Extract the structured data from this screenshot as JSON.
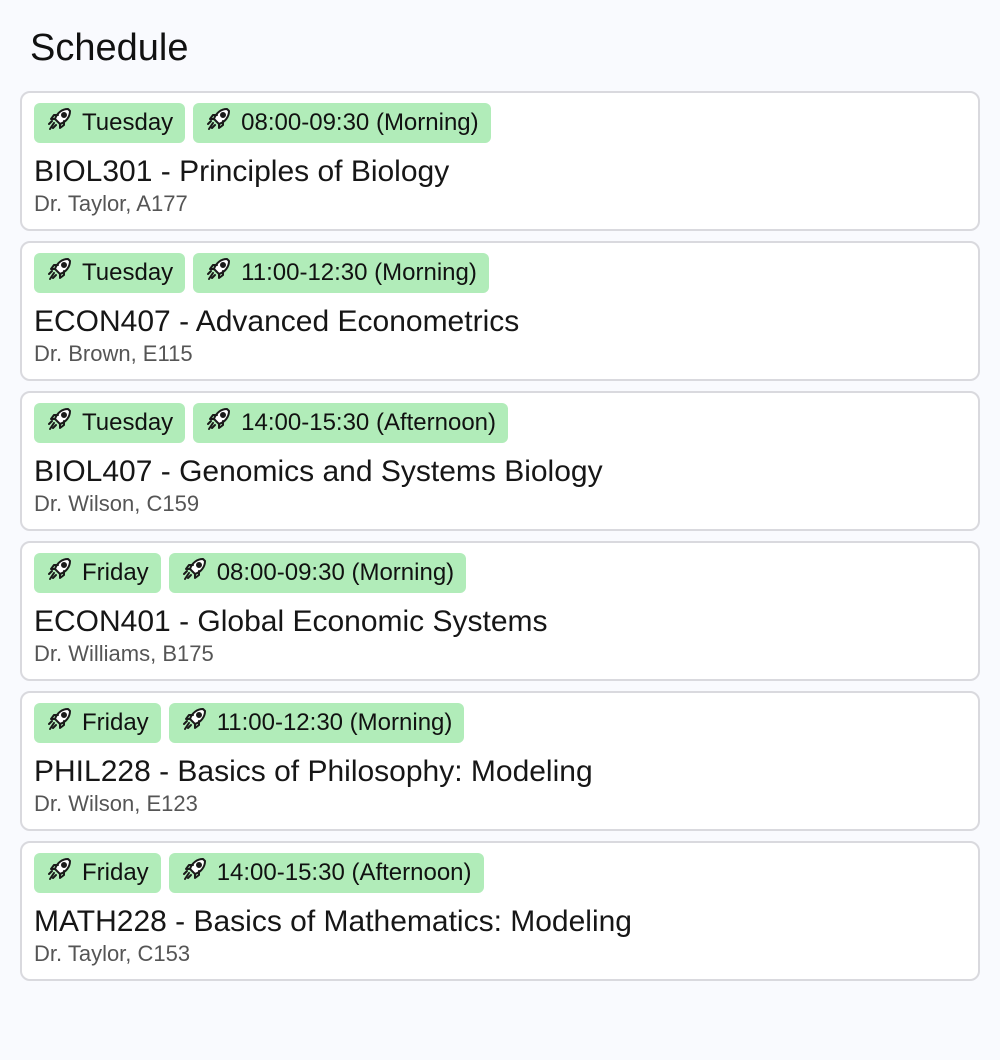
{
  "page": {
    "title": "Schedule"
  },
  "classes": [
    {
      "day": "Tuesday",
      "time": "08:00-09:30 (Morning)",
      "course": "BIOL301 - Principles of Biology",
      "details": "Dr. Taylor, A177"
    },
    {
      "day": "Tuesday",
      "time": "11:00-12:30 (Morning)",
      "course": "ECON407 - Advanced Econometrics",
      "details": "Dr. Brown, E115"
    },
    {
      "day": "Tuesday",
      "time": "14:00-15:30 (Afternoon)",
      "course": "BIOL407 - Genomics and Systems Biology",
      "details": "Dr. Wilson, C159"
    },
    {
      "day": "Friday",
      "time": "08:00-09:30 (Morning)",
      "course": "ECON401 - Global Economic Systems",
      "details": "Dr. Williams, B175"
    },
    {
      "day": "Friday",
      "time": "11:00-12:30 (Morning)",
      "course": "PHIL228 - Basics of Philosophy: Modeling",
      "details": "Dr. Wilson, E123"
    },
    {
      "day": "Friday",
      "time": "14:00-15:30 (Afternoon)",
      "course": "MATH228 - Basics of Mathematics: Modeling",
      "details": "Dr. Taylor, C153"
    }
  ],
  "icons": {
    "badge_icon": "rocket-icon"
  },
  "colors": {
    "background": "#f9fafe",
    "card_border": "#d9d9de",
    "badge_background": "#b1ecb9",
    "secondary_text": "#555555"
  }
}
